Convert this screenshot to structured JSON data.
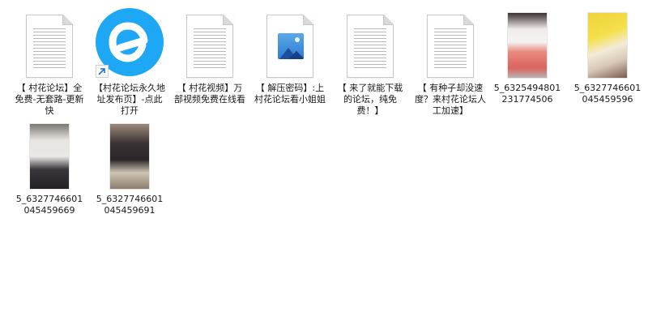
{
  "items": [
    {
      "label": "【 村花论坛】全免费-无套路-更新快",
      "icon": "text-document-icon"
    },
    {
      "label": "【村花论坛永久地址发布页】-点此打开",
      "icon": "app-shortcut-icon"
    },
    {
      "label": "【 村花视频】万部视频免费在线看",
      "icon": "text-document-icon"
    },
    {
      "label": "【 解压密码】:上村花论坛看小姐姐",
      "icon": "image-document-icon"
    },
    {
      "label": "【 来了就能下载的论坛，纯免费！】",
      "icon": "text-document-icon"
    },
    {
      "label": "【 有种子却没速度？来村花论坛人工加速】",
      "icon": "text-document-icon"
    },
    {
      "label": "5_6325494801231774506",
      "icon": "photo-thumbnail"
    },
    {
      "label": "5_6327746601045459596",
      "icon": "photo-thumbnail"
    },
    {
      "label": "5_6327746601045459669",
      "icon": "photo-thumbnail"
    },
    {
      "label": "5_6327746601045459691",
      "icon": "photo-thumbnail"
    }
  ],
  "colors": {
    "app_icon": "#1ea7f5",
    "background": "#ffffff",
    "text": "#1a1a1a"
  }
}
